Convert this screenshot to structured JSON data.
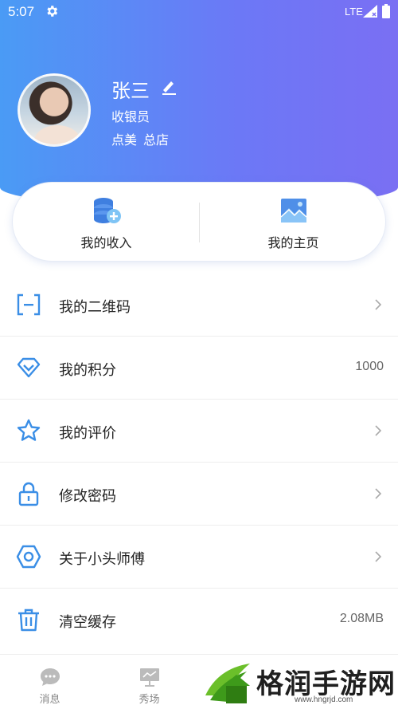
{
  "status_bar": {
    "time": "5:07",
    "network": "LTE"
  },
  "profile": {
    "name": "张三",
    "role": "收银员",
    "store_brand": "点美",
    "store_name": "总店"
  },
  "quick_actions": [
    {
      "label": "我的收入",
      "icon": "income-coins-icon"
    },
    {
      "label": "我的主页",
      "icon": "homepage-image-icon"
    }
  ],
  "menu": [
    {
      "label": "我的二维码",
      "icon": "qr-code-icon",
      "value": "",
      "chevron": true
    },
    {
      "label": "我的积分",
      "icon": "diamond-icon",
      "value": "1000",
      "chevron": false
    },
    {
      "label": "我的评价",
      "icon": "star-icon",
      "value": "",
      "chevron": true
    },
    {
      "label": "修改密码",
      "icon": "lock-icon",
      "value": "",
      "chevron": true
    },
    {
      "label": "关于小头师傅",
      "icon": "hexagon-icon",
      "value": "",
      "chevron": true
    },
    {
      "label": "清空缓存",
      "icon": "trash-icon",
      "value": "2.08MB",
      "chevron": false
    }
  ],
  "tab_bar": [
    {
      "label": "消息",
      "icon": "message-icon"
    },
    {
      "label": "秀场",
      "icon": "showroom-icon"
    }
  ],
  "watermark": {
    "text": "格润手游网",
    "url": "www.hngrjd.com"
  },
  "colors": {
    "header_start": "#4a9bf5",
    "header_end": "#7a6ff3",
    "icon_blue": "#3a8ee6"
  }
}
